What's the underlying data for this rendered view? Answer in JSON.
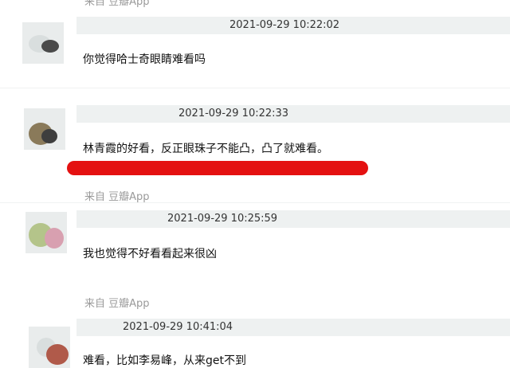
{
  "source_label": "来自 豆瓣App",
  "source_label_top_partial": "来自 豆瓣App",
  "comments": [
    {
      "timestamp": "2021-09-29 10:22:02",
      "text": "你觉得哈士奇眼睛难看吗"
    },
    {
      "timestamp": "2021-09-29 10:22:33",
      "text": "林青霞的好看，反正眼珠子不能凸，凸了就难看。"
    },
    {
      "timestamp": "2021-09-29 10:25:59",
      "text": "我也觉得不好看看起来很凶"
    },
    {
      "timestamp": "2021-09-29 10:41:04",
      "text": "难看，比如李易峰，从来get不到"
    }
  ],
  "colors": {
    "highlight": "#e41111",
    "timebar": "#eef1f1",
    "muted": "#9a9a9a"
  }
}
